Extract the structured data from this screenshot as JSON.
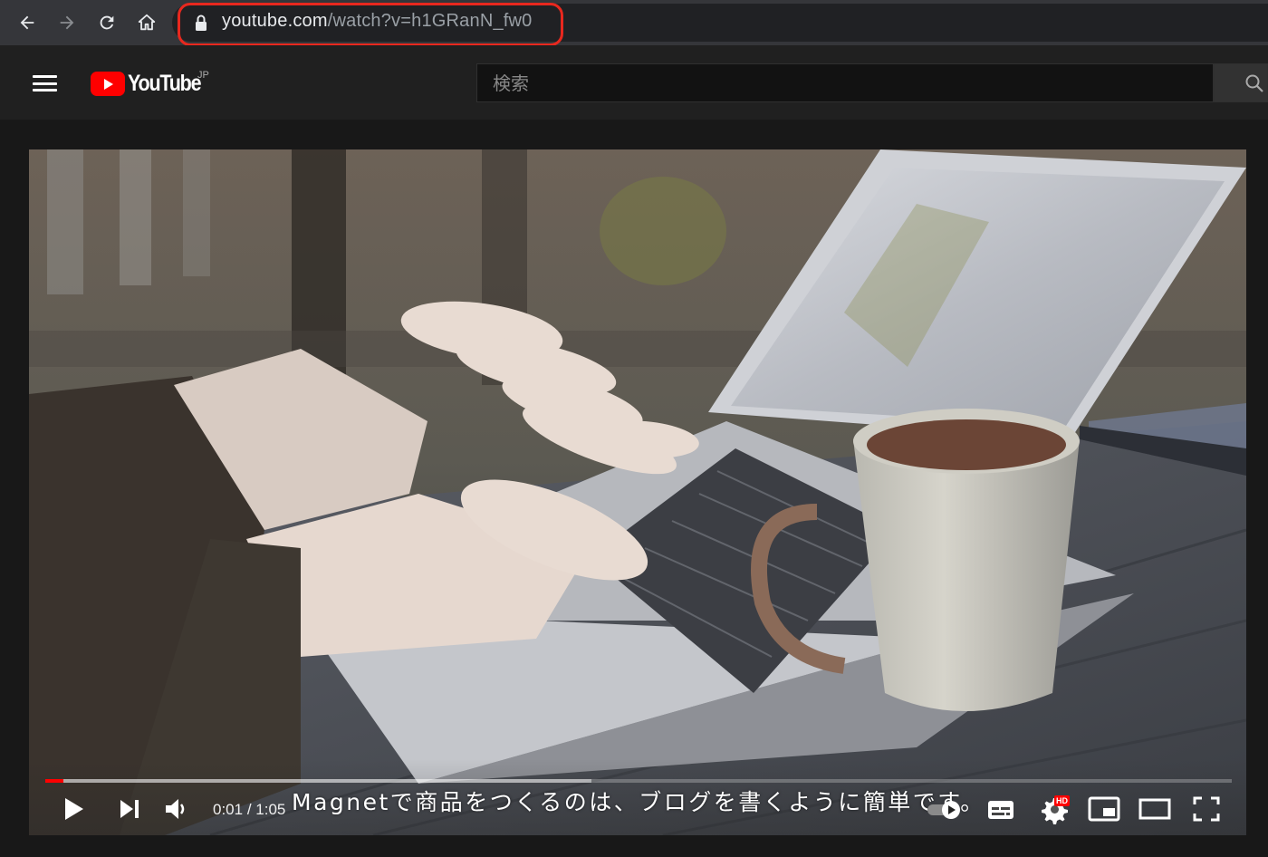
{
  "browser": {
    "url_host": "youtube.com",
    "url_path": "/watch?v=h1GRanN_fw0"
  },
  "header": {
    "logo_text": "YouTube",
    "region": "JP",
    "search_placeholder": "検索"
  },
  "player": {
    "time_current": "0:01",
    "time_separator": " / ",
    "time_total": "1:05",
    "caption": "Magnetで商品をつくるのは、ブログを書くように簡単です。",
    "progress_played": 0.015,
    "progress_buffered": 0.46,
    "hd_badge": "HD"
  },
  "colors": {
    "accent": "#ff0000",
    "url_highlight": "#e8281e",
    "background": "#181818",
    "header": "#202020"
  }
}
